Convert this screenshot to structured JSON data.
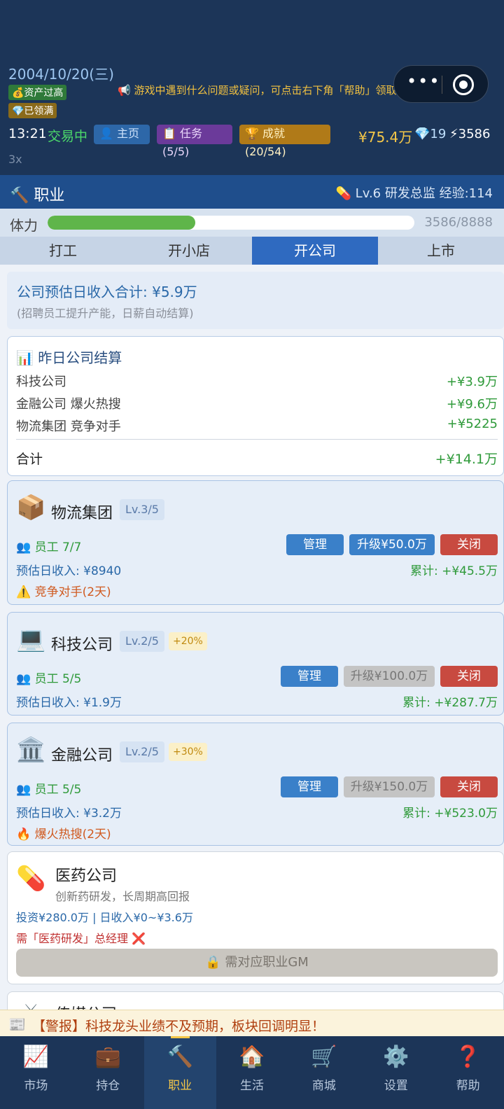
{
  "header": {
    "date": "2004/10/20(三)",
    "badge_assets": "💰资产过高",
    "badge_gems": "💎已领满",
    "notice": "📢 游戏中遇到什么问题或疑问，可点击右下角「帮助」领取兑换码",
    "time": "13:21",
    "status": "交易中",
    "home": "👤 主页",
    "tasks": "📋 任务(5/5)",
    "achievements": "🏆 成就(20/54)",
    "money": "¥75.4万",
    "gems": "💎19",
    "energy": "⚡3586",
    "speed": "3x"
  },
  "career": {
    "title": "🔨 职业",
    "info": "💊 Lv.6 研发总监  经验:114"
  },
  "stamina": {
    "label": "体力",
    "value": "3586/8888",
    "fraction": 0.4035
  },
  "tabs": [
    "打工",
    "开小店",
    "开公司",
    "上市"
  ],
  "active_tab": 2,
  "summary": {
    "total": "公司预估日收入合计: ¥5.9万",
    "note": "(招聘员工提升产能，日薪自动结算)"
  },
  "settlement": {
    "title": "📊 昨日公司结算",
    "rows": [
      {
        "label": "科技公司",
        "value": "+¥3.9万"
      },
      {
        "label": "金融公司  爆火热搜",
        "value": "+¥9.6万"
      },
      {
        "label": "物流集团  竞争对手",
        "value": "+¥5225"
      }
    ],
    "total_label": "合计",
    "total_value": "+¥14.1万"
  },
  "companies": [
    {
      "icon": "📦",
      "name": "物流集团",
      "level": "Lv.3/5",
      "bonus": "",
      "staff": "👥 员工 7/7",
      "manage": "管理",
      "upgrade": "升级¥50.0万",
      "close": "关闭",
      "est": "预估日收入: ¥8940",
      "cum": "累计: +¥45.5万",
      "event": "⚠️ 竞争对手(2天)"
    },
    {
      "icon": "💻",
      "name": "科技公司",
      "level": "Lv.2/5",
      "bonus": "+20%",
      "staff": "👥 员工 5/5",
      "manage": "管理",
      "upgrade": "升级¥100.0万",
      "close": "关闭",
      "est": "预估日收入: ¥1.9万",
      "cum": "累计: +¥287.7万",
      "event": ""
    },
    {
      "icon": "🏛️",
      "name": "金融公司",
      "level": "Lv.2/5",
      "bonus": "+30%",
      "staff": "👥 员工 5/5",
      "manage": "管理",
      "upgrade": "升级¥150.0万",
      "close": "关闭",
      "est": "预估日收入: ¥3.2万",
      "cum": "累计: +¥523.0万",
      "event": "🔥 爆火热搜(2天)"
    }
  ],
  "locked": {
    "icon": "💊",
    "name": "医药公司",
    "desc": "创新药研发，长周期高回报",
    "invest": "投资¥280.0万 | 日收入¥0~¥3.6万",
    "requirement": "需「医药研发」总经理 ❌",
    "button": "🔒 需对应职业GM"
  },
  "next_company": {
    "icon": "📺",
    "name": "传媒公司"
  },
  "ticker": {
    "icon": "📰",
    "text": "【警报】科技龙头业绩不及预期，板块回调明显！"
  },
  "nav": [
    {
      "icon": "📈",
      "label": "市场"
    },
    {
      "icon": "💼",
      "label": "持仓"
    },
    {
      "icon": "🔨",
      "label": "职业"
    },
    {
      "icon": "🏠",
      "label": "生活"
    },
    {
      "icon": "🛒",
      "label": "商城"
    },
    {
      "icon": "⚙️",
      "label": "设置"
    },
    {
      "icon": "❓",
      "label": "帮助"
    }
  ],
  "active_nav": 2
}
